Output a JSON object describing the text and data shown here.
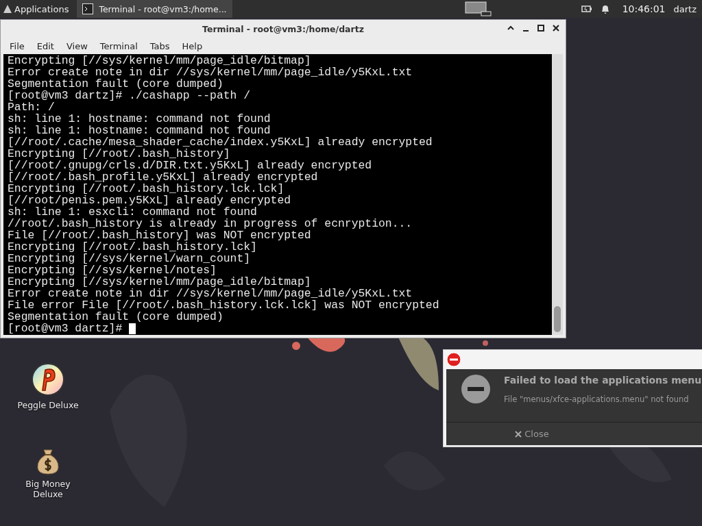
{
  "panel": {
    "apps_button": "Applications",
    "tasks": [
      {
        "label": "Terminal - root@vm3:/home...",
        "selected": true
      }
    ],
    "clock": "10:46:01",
    "user": "dartz"
  },
  "terminal": {
    "title": "Terminal - root@vm3:/home/dartz",
    "menu": [
      "File",
      "Edit",
      "View",
      "Terminal",
      "Tabs",
      "Help"
    ],
    "lines": [
      "Encrypting [//sys/kernel/mm/page_idle/bitmap]",
      "Error create note in dir //sys/kernel/mm/page_idle/y5KxL.txt",
      "Segmentation fault (core dumped)",
      "[root@vm3 dartz]# ./cashapp --path /",
      "Path: /",
      "sh: line 1: hostname: command not found",
      "sh: line 1: hostname: command not found",
      "[//root/.cache/mesa_shader_cache/index.y5KxL] already encrypted",
      "Encrypting [//root/.bash_history]",
      "[//root/.gnupg/crls.d/DIR.txt.y5KxL] already encrypted",
      "[//root/.bash_profile.y5KxL] already encrypted",
      "Encrypting [//root/.bash_history.lck.lck]",
      "[//root/penis.pem.y5KxL] already encrypted",
      "sh: line 1: esxcli: command not found",
      "//root/.bash_history is already in progress of ecnryption...",
      "File [//root/.bash_history] was NOT encrypted",
      "Encrypting [//root/.bash_history.lck]",
      "Encrypting [//sys/kernel/warn_count]",
      "Encrypting [//sys/kernel/notes]",
      "Encrypting [//sys/kernel/mm/page_idle/bitmap]",
      "Error create note in dir //sys/kernel/mm/page_idle/y5KxL.txt",
      "File error File [//root/.bash_history.lck.lck] was NOT encrypted",
      "Segmentation fault (core dumped)",
      "[root@vm3 dartz]# "
    ]
  },
  "notification": {
    "title": "Failed to load the applications menu",
    "body": "File \"menus/xfce-applications.menu\" not found",
    "button": "Close"
  },
  "desktop_icons": [
    {
      "label": "Peggle Deluxe",
      "kind": "game"
    },
    {
      "label": "Big Money Deluxe",
      "kind": "money"
    }
  ]
}
